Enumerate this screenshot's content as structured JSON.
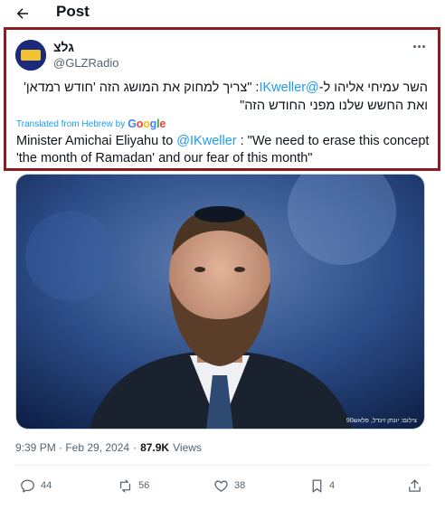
{
  "header": {
    "title": "Post"
  },
  "tweet": {
    "display_name": "גלצ",
    "avatar_text": "גלצ",
    "handle": "@GLZRadio",
    "original": {
      "before": "השר עמיחי אליהו ל-",
      "mention": "@IKweller",
      "after": ": \"צריך למחוק את המושג הזה 'חודש רמדאן' ואת החשש שלנו מפני החודש הזה\""
    },
    "translated_label": "Translated from Hebrew by",
    "google": [
      "G",
      "o",
      "o",
      "g",
      "l",
      "e"
    ],
    "translation": {
      "before": "Minister Amichai Eliyahu to ",
      "mention": "@IKweller",
      "after": " : \"We need to erase this concept 'the month of Ramadan' and our fear of this month\""
    },
    "photo_credit": "צילום: יונתן זינדל, פלאש90",
    "time": "9:39 PM · Feb 29, 2024",
    "separator": "·",
    "views_count": "87.9K",
    "views_label": "Views",
    "stats": {
      "replies": "44",
      "reposts": "56",
      "likes": "38",
      "bookmarks": "4"
    }
  },
  "colors": {
    "accent": "#1d9bf0",
    "highlight_border": "#8a1c22",
    "muted": "#536471"
  }
}
